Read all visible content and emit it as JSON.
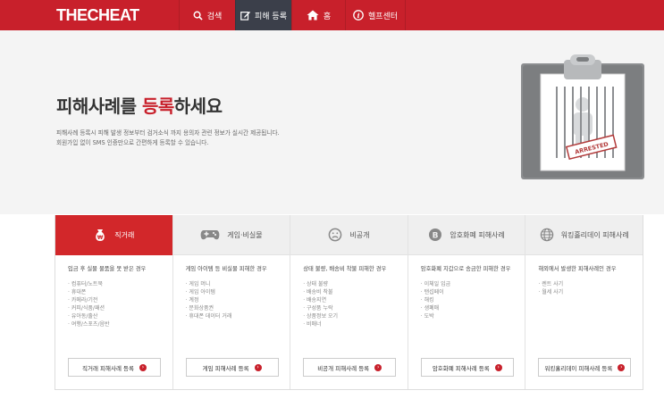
{
  "header": {
    "logo": "THECHEAT",
    "nav": [
      {
        "label": "검색",
        "icon": "search-icon"
      },
      {
        "label": "피해 등록",
        "icon": "edit-icon"
      },
      {
        "label": "홈",
        "icon": "home-icon"
      },
      {
        "label": "헬프센터",
        "icon": "info-icon"
      }
    ]
  },
  "hero": {
    "title_pre": "피해사례를 ",
    "title_accent": "등록",
    "title_post": "하세요",
    "desc_line1": "피해사례 등록시 피해 발생 정보부터 검거소식 까지 용의자 관련 정보가 실시간 제공됩니다.",
    "desc_line2": "회원가입 없이 SMS 인증만으로 간편하게 등록할 수 있습니다.",
    "stamp": "ARRESTED"
  },
  "cards": [
    {
      "title": "직거래",
      "icon": "money-bag-icon",
      "subtitle": "입금 후 실물 물품을 못 받은 경우",
      "items": [
        "컴퓨터/노트북",
        "휴대폰",
        "카메라/기전",
        "커피/식품/패션",
        "유아동/출산",
        "여행/스포츠/음반"
      ],
      "button": "직거래 피해사례 등록"
    },
    {
      "title": "게임·비실물",
      "icon": "gamepad-icon",
      "subtitle": "게임 아이템 등 비실물 피해한 경우",
      "items": [
        "게임 머니",
        "게임 아이템",
        "계정",
        "문화상품권",
        "휴대폰 데이터 거래"
      ],
      "button": "게임 피해사례 등록"
    },
    {
      "title": "비공개",
      "icon": "sad-face-icon",
      "subtitle": "상태 불량, 배송비 착불 피해한 경우",
      "items": [
        "상태 불량",
        "배송비 착불",
        "배송지연",
        "구성품 누락",
        "상품정보 오기",
        "비매너"
      ],
      "button": "비공개 피해사례 등록"
    },
    {
      "title": "암호화폐 피해사례",
      "icon": "bitcoin-icon",
      "subtitle": "암호화폐 지갑으로 송금한 피해한 경우",
      "items": [
        "이체일 입금",
        "탠섭페이",
        "해킹",
        "생폐매",
        "도박"
      ],
      "button": "암호화폐 피해사례 등록"
    },
    {
      "title": "워킹홀리데이 피해사례",
      "icon": "globe-icon",
      "subtitle": "해외에서 발생한 피해사례인 경우",
      "items": [
        "렌트 사기",
        "월세 사기"
      ],
      "button": "워킹홀리데이 피해사례 등록"
    }
  ],
  "colors": {
    "brand": "#c8202b",
    "nav_active": "#3b3f4a",
    "hero_bg": "#f4f4f4",
    "card_head": "#efefef"
  }
}
